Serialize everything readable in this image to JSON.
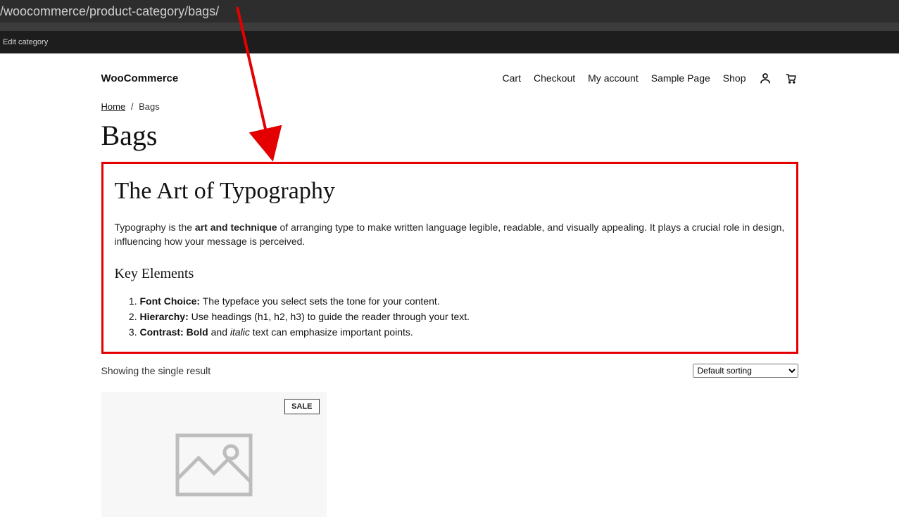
{
  "url_bar": "/woocommerce/product-category/bags/",
  "admin_bar": {
    "edit_category": "Edit category"
  },
  "site_title": "WooCommerce",
  "nav": {
    "cart": "Cart",
    "checkout": "Checkout",
    "my_account": "My account",
    "sample_page": "Sample Page",
    "shop": "Shop"
  },
  "breadcrumb": {
    "home": "Home",
    "sep": "/",
    "current": "Bags"
  },
  "category_title": "Bags",
  "typography": {
    "heading": "The Art of Typography",
    "para_1": "Typography is the ",
    "para_bold": "art and technique",
    "para_2": " of arranging type to make written language legible, readable, and visually appealing. It plays a crucial role in design, influencing how your message is perceived.",
    "sub_heading": "Key Elements",
    "li1_label": "Font Choice:",
    "li1_text": " The typeface you select sets the tone for your content.",
    "li2_label": "Hierarchy:",
    "li2_text": " Use headings (h1, h2, h3) to guide the reader through your text.",
    "li3_label": "Contrast:",
    "li3_b": " Bold",
    "li3_mid": " and ",
    "li3_i": "italic",
    "li3_tail": " text can emphasize important points."
  },
  "results": {
    "count_text": "Showing the single result",
    "sort_label": "Default sorting"
  },
  "product": {
    "sale_badge": "SALE"
  }
}
